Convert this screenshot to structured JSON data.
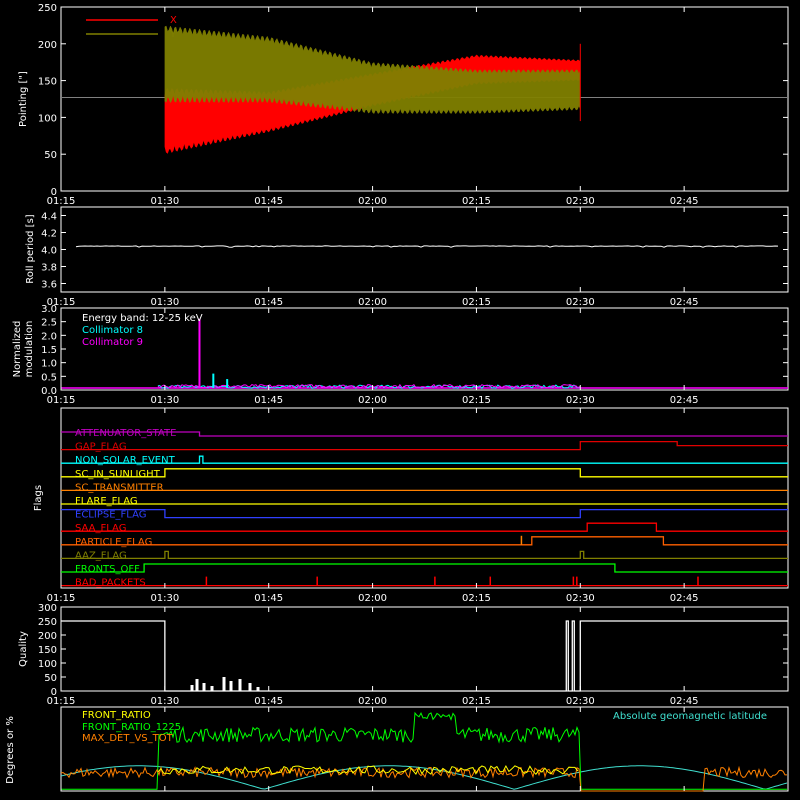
{
  "chart_data": [
    {
      "type": "line",
      "panel": "pointing",
      "ylabel": "Pointing [\"]",
      "ylim": [
        0,
        250
      ],
      "yticks": [
        "0",
        "50",
        "100",
        "150",
        "200",
        "250"
      ],
      "xticks": [
        "01:15",
        "01:30",
        "01:45",
        "02:00",
        "02:15",
        "02:30",
        "02:45"
      ],
      "legend": [
        "X",
        "Y"
      ],
      "colors": {
        "X": "#ff0000",
        "Y": "#808000",
        "ref": "#808080"
      },
      "reference_line": 127,
      "series": [
        {
          "name": "X",
          "x": [
            "01:30",
            "01:45",
            "02:00",
            "02:15",
            "02:30"
          ],
          "min": [
            50,
            80,
            115,
            145,
            150
          ],
          "max": [
            140,
            135,
            160,
            185,
            178
          ]
        },
        {
          "name": "Y",
          "x": [
            "01:30",
            "01:45",
            "02:00",
            "02:15",
            "02:30"
          ],
          "min": [
            120,
            120,
            105,
            105,
            110
          ],
          "max": [
            225,
            210,
            175,
            165,
            165
          ]
        }
      ]
    },
    {
      "type": "line",
      "panel": "roll",
      "ylabel": "Roll period [s]",
      "ylim": [
        3.5,
        4.5
      ],
      "yticks": [
        "3.6",
        "3.8",
        "4.0",
        "4.2",
        "4.4"
      ],
      "xticks": [
        "01:15",
        "01:30",
        "01:45",
        "02:00",
        "02:15",
        "02:30",
        "02:45"
      ],
      "series": [
        {
          "name": "",
          "value": 4.04
        }
      ]
    },
    {
      "type": "line",
      "panel": "modulation",
      "ylabel_lines": [
        "Normalized",
        "modulation"
      ],
      "ylim": [
        0,
        3.0
      ],
      "yticks": [
        "0.0",
        "0.5",
        "1.0",
        "1.5",
        "2.0",
        "2.5",
        "3.0"
      ],
      "xticks": [
        "01:15",
        "01:30",
        "01:45",
        "02:00",
        "02:15",
        "02:30",
        "02:45"
      ],
      "legend": [
        "Energy band: 12-25 keV",
        "Collimator 8",
        "Collimator 9"
      ],
      "colors": {
        "c8": "#00ffff",
        "c9": "#ff00ff"
      },
      "spikes": [
        {
          "series": "Collimator 9",
          "x": "01:35",
          "value": 2.6
        },
        {
          "series": "Collimator 8",
          "x": "01:37",
          "value": 0.6
        },
        {
          "series": "Collimator 8",
          "x": "01:39",
          "value": 0.4
        }
      ]
    },
    {
      "type": "line",
      "panel": "flags",
      "ylabel": "Flags",
      "xticks": [
        "01:15",
        "01:30",
        "01:45",
        "02:00",
        "02:15",
        "02:30",
        "02:45"
      ],
      "series": [
        {
          "name": "ATTENUATOR_STATE",
          "color": "#c000c0"
        },
        {
          "name": "GAP_FLAG",
          "color": "#e00000"
        },
        {
          "name": "NON_SOLAR_EVENT",
          "color": "#00ffff"
        },
        {
          "name": "SC_IN_SUNLIGHT",
          "color": "#ffff00"
        },
        {
          "name": "SC_TRANSMITTER",
          "color": "#ff8000"
        },
        {
          "name": "FLARE_FLAG",
          "color": "#ffff00"
        },
        {
          "name": "ECLIPSE_FLAG",
          "color": "#3040ff"
        },
        {
          "name": "SAA_FLAG",
          "color": "#ff0000"
        },
        {
          "name": "PARTICLE_FLAG",
          "color": "#ff6000"
        },
        {
          "name": "AAZ_FLAG",
          "color": "#808000"
        },
        {
          "name": "FRONTS_OFF",
          "color": "#00ff00"
        },
        {
          "name": "BAD_PACKETS",
          "color": "#ff0000"
        }
      ]
    },
    {
      "type": "line",
      "panel": "quality",
      "ylabel": "Quality",
      "ylim": [
        0,
        300
      ],
      "yticks": [
        "0",
        "50",
        "100",
        "150",
        "200",
        "250",
        "300"
      ],
      "xticks": [
        "01:15",
        "01:30",
        "01:45",
        "02:00",
        "02:15",
        "02:30",
        "02:45"
      ],
      "series": [
        {
          "name": "",
          "x": [
            "01:15",
            "01:30",
            "02:28",
            "02:30",
            "02:50"
          ],
          "y": [
            250,
            0,
            250,
            0,
            250
          ]
        }
      ]
    },
    {
      "type": "line",
      "panel": "ratios",
      "ylabel": "Degrees or %",
      "ylim": [
        0,
        100
      ],
      "legend": [
        "FRONT_RATIO",
        "FRONT_RATIO_1225",
        "MAX_DET_VS_TOT"
      ],
      "annotation": "Absolute geomagnetic latitude",
      "colors": {
        "FRONT_RATIO": "#ffff00",
        "FRONT_RATIO_1225": "#00ff00",
        "MAX_DET_VS_TOT": "#ff8000",
        "latitude": "#40e0d0"
      }
    }
  ]
}
